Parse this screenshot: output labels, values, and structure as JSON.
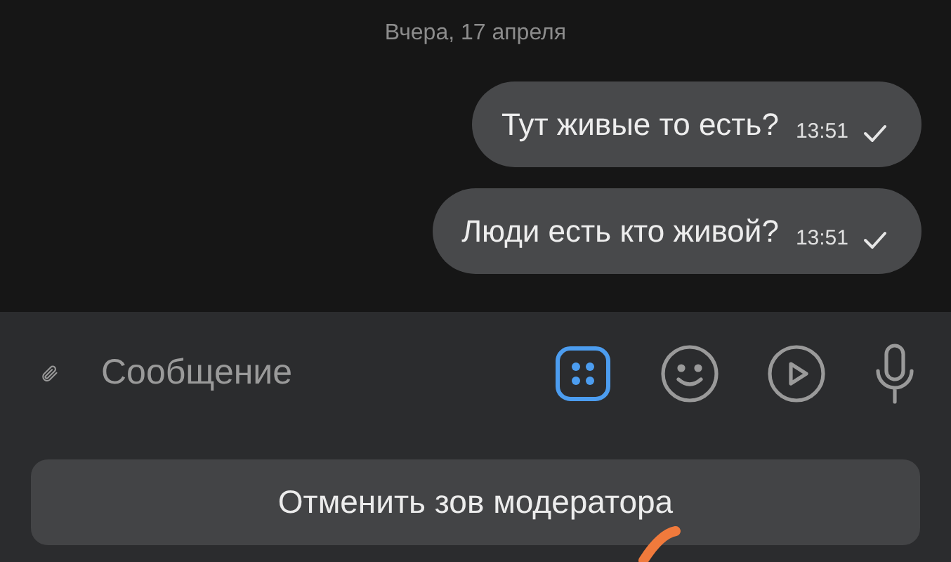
{
  "date_separator": "Вчера, 17 апреля",
  "messages": [
    {
      "text": "Тут живые то есть?",
      "time": "13:51",
      "read": false
    },
    {
      "text": "Люди есть кто живой?",
      "time": "13:51",
      "read": false
    }
  ],
  "composer": {
    "placeholder": "Сообщение"
  },
  "action_button": "Отменить зов модератора"
}
